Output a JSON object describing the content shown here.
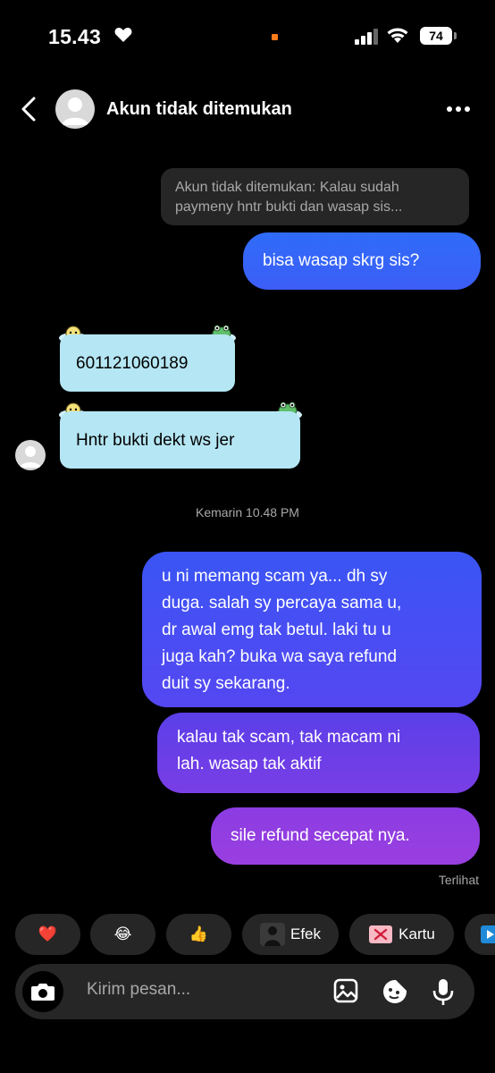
{
  "status_bar": {
    "time": "15.43",
    "battery": "74"
  },
  "header": {
    "title": "Akun tidak ditemukan"
  },
  "messages": {
    "reply_preview": [
      "Akun tidak ditemukan: Kalau sudah",
      "paymeny hntr bukti dan wasap sis..."
    ],
    "out_1": "bisa wasap skrg sis?",
    "in_1": "601121060189",
    "in_2": "Hntr bukti dekt ws jer",
    "timestamp": "Kemarin 10.48 PM",
    "out_2": [
      "u ni memang scam ya... dh sy",
      "duga. salah sy percaya sama u,",
      "dr awal emg tak betul. laki tu u",
      "juga kah? buka wa saya refund",
      "duit sy sekarang."
    ],
    "out_3": [
      "kalau tak scam, tak macam ni",
      "lah. wasap tak aktif"
    ],
    "out_4": "sile refund secepat nya.",
    "seen": "Terlihat"
  },
  "quick_reactions": {
    "heart": "❤️",
    "laugh": "😂",
    "thumbs_up": "👍",
    "effect_label": "Efek",
    "card_label": "Kartu"
  },
  "composer": {
    "placeholder": "Kirim pesan..."
  },
  "colors": {
    "outgoing_start": "#2f6cf8",
    "outgoing_end": "#9a3fe0",
    "incoming": "#b5e6f3",
    "reply_bg": "#262626"
  }
}
